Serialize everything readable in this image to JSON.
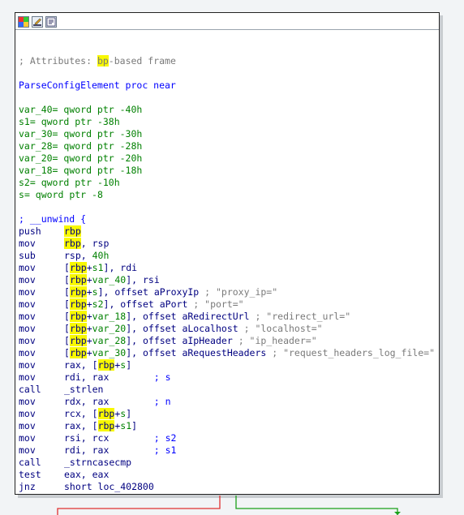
{
  "toolbar": {
    "icons": [
      "color-palette-icon",
      "edit-pencil-icon",
      "graph-overview-icon"
    ]
  },
  "header": {
    "attr_prefix": "; Attributes: ",
    "attr_hl": "bp",
    "attr_suffix": "-based frame",
    "proc": "ParseConfigElement proc near"
  },
  "vars": [
    {
      "name": "var_40",
      "def": "= qword ptr -40h"
    },
    {
      "name": "s1",
      "def": "= qword ptr -38h"
    },
    {
      "name": "var_30",
      "def": "= qword ptr -30h"
    },
    {
      "name": "var_28",
      "def": "= qword ptr -28h"
    },
    {
      "name": "var_20",
      "def": "= qword ptr -20h"
    },
    {
      "name": "var_18",
      "def": "= qword ptr -18h"
    },
    {
      "name": "s2",
      "def": "= qword ptr -10h"
    },
    {
      "name": "s",
      "def": "= qword ptr -8"
    }
  ],
  "unwind": "; __unwind {",
  "code": [
    {
      "m": "push",
      "p": [
        {
          "t": "rbp",
          "h": 1
        }
      ]
    },
    {
      "m": "mov",
      "p": [
        {
          "t": "rbp",
          "h": 1
        },
        {
          "t": ", rsp"
        }
      ]
    },
    {
      "m": "sub",
      "p": [
        {
          "t": "rsp, "
        },
        {
          "t": "40h",
          "c": "num"
        }
      ]
    },
    {
      "m": "mov",
      "p": [
        {
          "t": "["
        },
        {
          "t": "rbp",
          "h": 1
        },
        {
          "t": "+"
        },
        {
          "t": "s1",
          "c": "grn"
        },
        {
          "t": "], rdi"
        }
      ]
    },
    {
      "m": "mov",
      "p": [
        {
          "t": "["
        },
        {
          "t": "rbp",
          "h": 1
        },
        {
          "t": "+"
        },
        {
          "t": "var_40",
          "c": "grn"
        },
        {
          "t": "], rsi"
        }
      ]
    },
    {
      "m": "mov",
      "p": [
        {
          "t": "["
        },
        {
          "t": "rbp",
          "h": 1
        },
        {
          "t": "+"
        },
        {
          "t": "s",
          "c": "grn"
        },
        {
          "t": "], offset aProxyIp"
        },
        {
          "t": " ; \"proxy_ip=\"",
          "c": "strc"
        }
      ]
    },
    {
      "m": "mov",
      "p": [
        {
          "t": "["
        },
        {
          "t": "rbp",
          "h": 1
        },
        {
          "t": "+"
        },
        {
          "t": "s2",
          "c": "grn"
        },
        {
          "t": "], offset aPort"
        },
        {
          "t": " ; \"port=\"",
          "c": "strc"
        }
      ]
    },
    {
      "m": "mov",
      "p": [
        {
          "t": "["
        },
        {
          "t": "rbp",
          "h": 1
        },
        {
          "t": "+"
        },
        {
          "t": "var_18",
          "c": "grn"
        },
        {
          "t": "], offset aRedirectUrl"
        },
        {
          "t": " ; \"redirect_url=\"",
          "c": "strc"
        }
      ]
    },
    {
      "m": "mov",
      "p": [
        {
          "t": "["
        },
        {
          "t": "rbp",
          "h": 1
        },
        {
          "t": "+"
        },
        {
          "t": "var_20",
          "c": "grn"
        },
        {
          "t": "], offset aLocalhost"
        },
        {
          "t": " ; \"localhost=\"",
          "c": "strc"
        }
      ]
    },
    {
      "m": "mov",
      "p": [
        {
          "t": "["
        },
        {
          "t": "rbp",
          "h": 1
        },
        {
          "t": "+"
        },
        {
          "t": "var_28",
          "c": "grn"
        },
        {
          "t": "], offset aIpHeader"
        },
        {
          "t": " ; \"ip_header=\"",
          "c": "strc"
        }
      ]
    },
    {
      "m": "mov",
      "p": [
        {
          "t": "["
        },
        {
          "t": "rbp",
          "h": 1
        },
        {
          "t": "+"
        },
        {
          "t": "var_30",
          "c": "grn"
        },
        {
          "t": "], offset aRequestHeaders"
        },
        {
          "t": " ; \"request_headers_log_file=\"",
          "c": "strc"
        }
      ]
    },
    {
      "m": "mov",
      "p": [
        {
          "t": "rax, ["
        },
        {
          "t": "rbp",
          "h": 1
        },
        {
          "t": "+"
        },
        {
          "t": "s",
          "c": "grn"
        },
        {
          "t": "]"
        }
      ]
    },
    {
      "m": "mov",
      "p": [
        {
          "t": "rdi, rax        "
        },
        {
          "t": "; s",
          "c": "blue"
        }
      ]
    },
    {
      "m": "call",
      "p": [
        {
          "t": "_strlen",
          "c": "func"
        }
      ]
    },
    {
      "m": "mov",
      "p": [
        {
          "t": "rdx, rax        "
        },
        {
          "t": "; n",
          "c": "blue"
        }
      ]
    },
    {
      "m": "mov",
      "p": [
        {
          "t": "rcx, ["
        },
        {
          "t": "rbp",
          "h": 1
        },
        {
          "t": "+"
        },
        {
          "t": "s",
          "c": "grn"
        },
        {
          "t": "]"
        }
      ]
    },
    {
      "m": "mov",
      "p": [
        {
          "t": "rax, ["
        },
        {
          "t": "rbp",
          "h": 1
        },
        {
          "t": "+"
        },
        {
          "t": "s1",
          "c": "grn"
        },
        {
          "t": "]"
        }
      ]
    },
    {
      "m": "mov",
      "p": [
        {
          "t": "rsi, rcx        "
        },
        {
          "t": "; s2",
          "c": "blue"
        }
      ]
    },
    {
      "m": "mov",
      "p": [
        {
          "t": "rdi, rax        "
        },
        {
          "t": "; s1",
          "c": "blue"
        }
      ]
    },
    {
      "m": "call",
      "p": [
        {
          "t": "_strncasecmp",
          "c": "func"
        }
      ]
    },
    {
      "m": "test",
      "p": [
        {
          "t": "eax, eax"
        }
      ]
    },
    {
      "m": "jnz",
      "p": [
        {
          "t": "short loc_402800"
        }
      ]
    }
  ],
  "colors": {
    "highlight": "#f8f800",
    "edge_false": "#e03030",
    "edge_true": "#1aa01a"
  }
}
